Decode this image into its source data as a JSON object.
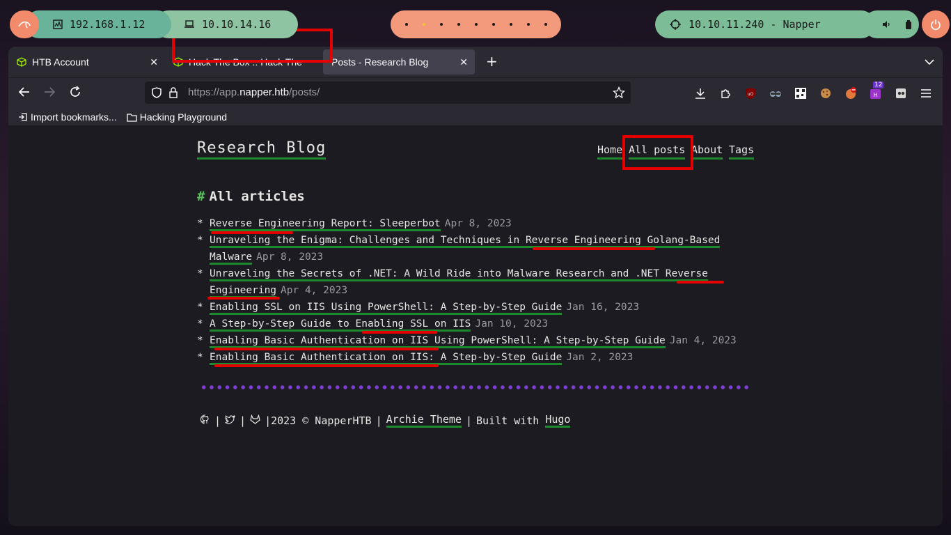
{
  "panel": {
    "ip_local": "192.168.1.12",
    "ip_vpn": "10.10.14.16",
    "target": "10.10.11.240 - Napper",
    "workspaces": 9,
    "active_workspace": 2
  },
  "browser": {
    "tabs": [
      {
        "title": "HTB Account"
      },
      {
        "title": "Hack The Box :: Hack The"
      },
      {
        "title": "Posts - Research Blog"
      }
    ],
    "url": {
      "scheme": "https://app.",
      "host": "napper.htb",
      "path": "/posts/"
    },
    "extension_badge": "12",
    "bookmarks": [
      {
        "label": "Import bookmarks..."
      },
      {
        "label": "Hacking Playground"
      }
    ]
  },
  "site": {
    "title": "Research Blog",
    "nav": [
      {
        "label": "Home"
      },
      {
        "label": "All posts"
      },
      {
        "label": "About"
      },
      {
        "label": "Tags"
      }
    ],
    "section_heading": "All articles",
    "section_hash": "#",
    "bullet": "*",
    "posts": [
      {
        "title": "Reverse Engineering Report: Sleeperbot",
        "date": "Apr 8, 2023"
      },
      {
        "title": "Unraveling the Enigma: Challenges and Techniques in Reverse Engineering Golang-Based Malware",
        "date": "Apr 8, 2023"
      },
      {
        "title": "Unraveling the Secrets of .NET: A Wild Ride into Malware Research and .NET Reverse Engineering",
        "date": "Apr 4, 2023"
      },
      {
        "title": "Enabling SSL on IIS Using PowerShell: A Step-by-Step Guide",
        "date": "Jan 16, 2023"
      },
      {
        "title": "A Step-by-Step Guide to Enabling SSL on IIS",
        "date": "Jan 10, 2023"
      },
      {
        "title": "Enabling Basic Authentication on IIS Using PowerShell: A Step-by-Step Guide",
        "date": "Jan 4, 2023"
      },
      {
        "title": "Enabling Basic Authentication on IIS: A Step-by-Step Guide",
        "date": "Jan 2, 2023"
      }
    ],
    "footer": {
      "sep": "|",
      "copyright": "2023 © NapperHTB",
      "theme_link": "Archie Theme",
      "built_with": "Built with",
      "hugo_link": "Hugo"
    }
  },
  "colors": {
    "link_underline": "#1c8b2b",
    "annotation_red": "#e50000",
    "separator_purple": "#7e3fd6"
  }
}
